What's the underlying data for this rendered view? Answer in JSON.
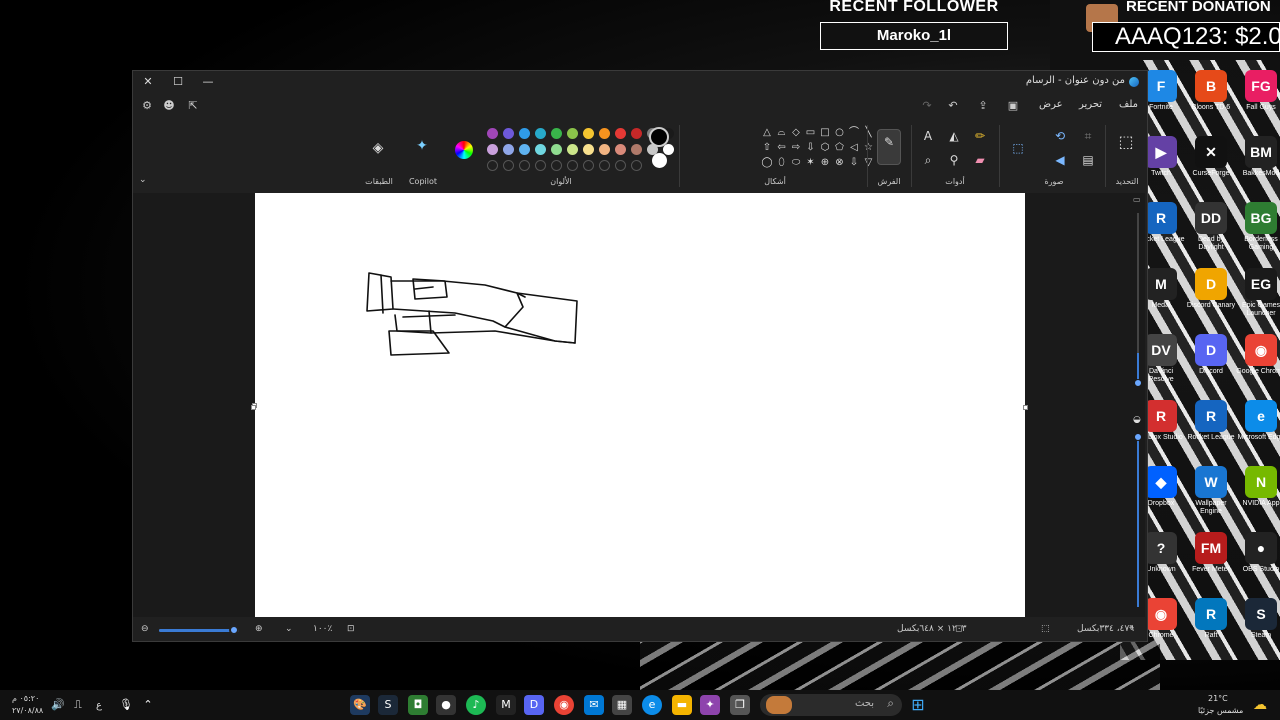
{
  "overlay": {
    "follower_title": "RECENT FOLLOWER",
    "follower_name": "Maroko_1l",
    "donation_title": "RECENT DONATION",
    "donation_value": "AAAQ123: $2.0"
  },
  "window": {
    "title": "من دون عنوان - الرسام"
  },
  "menu": {
    "file": "ملف",
    "edit": "تحرير",
    "view": "عرض"
  },
  "ribbon": {
    "selection_label": "التحديد",
    "image_label": "صورة",
    "tools_label": "أدوات",
    "brushes_label": "الفرش",
    "shapes_label": "أشكال",
    "colors_label": "الألوان",
    "copilot_label": "Copilot",
    "layers_label": "الطبقات"
  },
  "colors": {
    "row1": [
      "#a146b8",
      "#6e59d9",
      "#2f9be8",
      "#27a9c9",
      "#39b54a",
      "#8bc34a",
      "#f4c430",
      "#f7931e",
      "#e53935",
      "#c62828",
      "#7f7f7f",
      "#1a1a1a"
    ],
    "row2": [
      "#c9a0dc",
      "#8fa6e8",
      "#5fb3f0",
      "#6fd6e0",
      "#8fdc8f",
      "#cce68a",
      "#f8e08e",
      "#f2b482",
      "#d98a7a",
      "#b07a6a",
      "#c8c8c8",
      "#ffffff"
    ],
    "primary": "#000000",
    "secondary": "#ffffff"
  },
  "status": {
    "zoom": "١٠٠٪",
    "canvas_size": "١٢٠٣ × ٦٤٨بكسل",
    "cursor_pos": "٤٧٦، ٣٣٤بكسل"
  },
  "desktop_icons": [
    {
      "label": "Fortnite",
      "color": "#1e88e5",
      "glyph": "F"
    },
    {
      "label": "Bloons TD 6",
      "color": "#e64a19",
      "glyph": "B"
    },
    {
      "label": "Fall Guys",
      "color": "#e91e63",
      "glyph": "FG"
    },
    {
      "label": "Twitch",
      "color": "#6441a5",
      "glyph": "▶"
    },
    {
      "label": "CurseForge",
      "color": "#111111",
      "glyph": "✕"
    },
    {
      "label": "BakkesMod",
      "color": "#222222",
      "glyph": "BM"
    },
    {
      "label": "Rocket League",
      "color": "#1565c0",
      "glyph": "R"
    },
    {
      "label": "Dead by Daylight",
      "color": "#333333",
      "glyph": "DD"
    },
    {
      "label": "Borderless Gaming",
      "color": "#2e7d32",
      "glyph": "BG"
    },
    {
      "label": "Medal",
      "color": "#222222",
      "glyph": "M"
    },
    {
      "label": "Discord Canary",
      "color": "#f0a500",
      "glyph": "D"
    },
    {
      "label": "Epic Games Launcher",
      "color": "#1a1a1a",
      "glyph": "EG"
    },
    {
      "label": "DaVinci Resolve",
      "color": "#444444",
      "glyph": "DV"
    },
    {
      "label": "Discord",
      "color": "#5865f2",
      "glyph": "D"
    },
    {
      "label": "Google Chrome",
      "color": "#ea4335",
      "glyph": "◉"
    },
    {
      "label": "Roblox Studio",
      "color": "#d32f2f",
      "glyph": "R"
    },
    {
      "label": "Rocket League",
      "color": "#1565c0",
      "glyph": "R"
    },
    {
      "label": "Microsoft Edge",
      "color": "#0c8ce9",
      "glyph": "e"
    },
    {
      "label": "Dropbox",
      "color": "#0061ff",
      "glyph": "◆"
    },
    {
      "label": "Wallpaper Engine",
      "color": "#1976d2",
      "glyph": "W"
    },
    {
      "label": "NVIDIA App",
      "color": "#76b900",
      "glyph": "N"
    },
    {
      "label": "Unknown",
      "color": "#333333",
      "glyph": "?"
    },
    {
      "label": "Fever Meter",
      "color": "#b71c1c",
      "glyph": "FM"
    },
    {
      "label": "OBS Studio",
      "color": "#222222",
      "glyph": "●"
    },
    {
      "label": "Chrome",
      "color": "#ea4335",
      "glyph": "◉"
    },
    {
      "label": "Raft",
      "color": "#0277bd",
      "glyph": "R"
    },
    {
      "label": "Steam",
      "color": "#1b2838",
      "glyph": "S"
    }
  ],
  "taskbar": {
    "search_placeholder": "بحث",
    "weather_temp": "21°C",
    "weather_desc": "مشمس جزئيًا",
    "time": "٠٥:٢٠ م",
    "date": "٢٧/٠٨/٨٨",
    "lang": "ع"
  }
}
